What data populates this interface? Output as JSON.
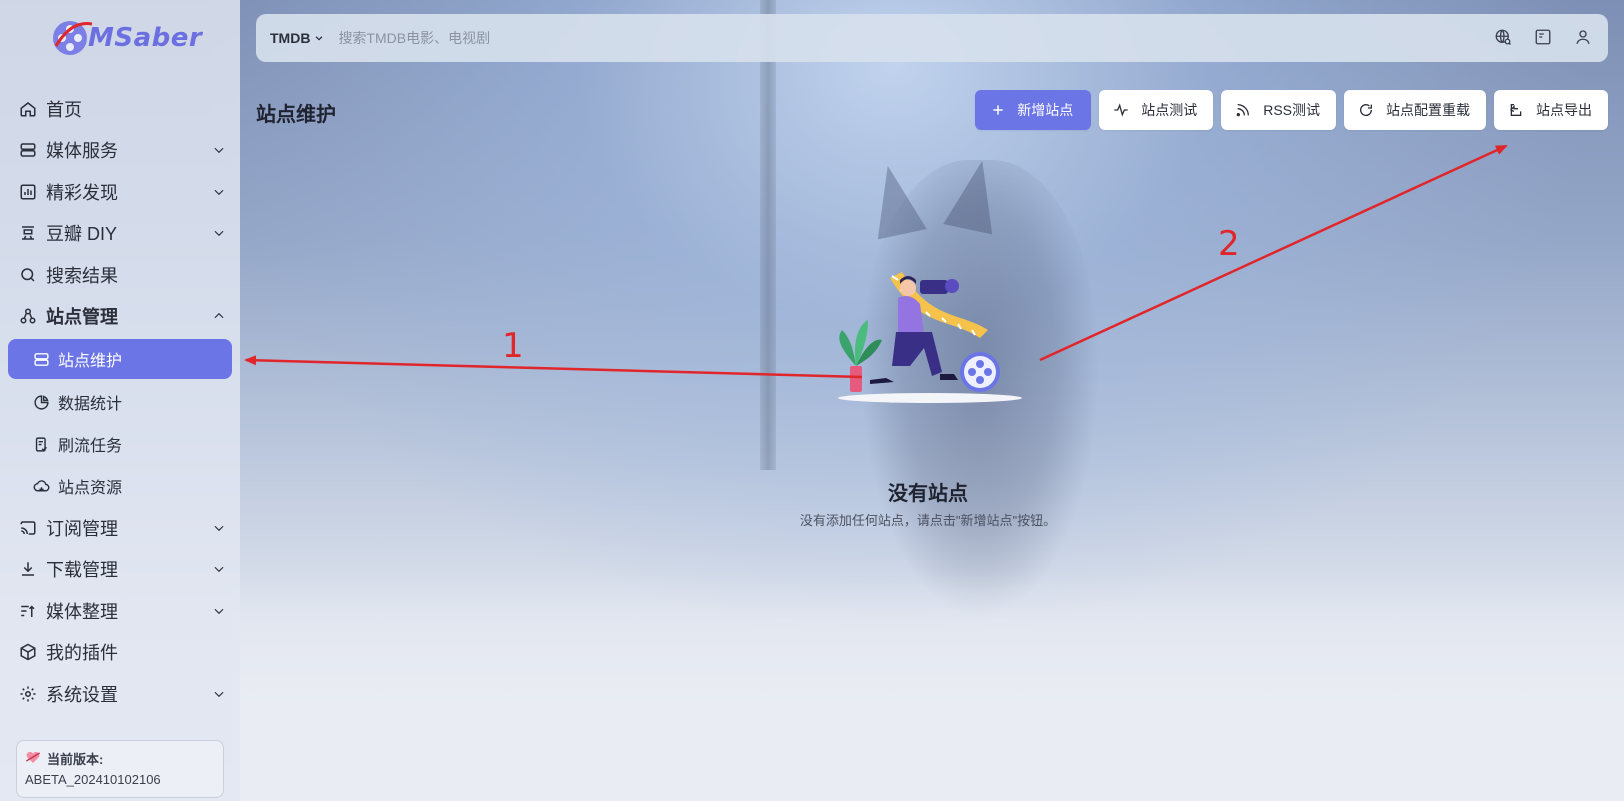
{
  "app": {
    "logo_text": "MSaber"
  },
  "sidebar": {
    "items": [
      {
        "label": "首页",
        "icon": "home-icon"
      },
      {
        "label": "媒体服务",
        "icon": "server-icon"
      },
      {
        "label": "精彩发现",
        "icon": "chart-icon"
      },
      {
        "label": "豆瓣 DIY",
        "icon": "douban-icon"
      },
      {
        "label": "搜索结果",
        "icon": "search-icon"
      },
      {
        "label": "站点管理",
        "icon": "sitemap-icon"
      },
      {
        "label": "订阅管理",
        "icon": "cast-icon"
      },
      {
        "label": "下载管理",
        "icon": "download-icon"
      },
      {
        "label": "媒体整理",
        "icon": "sort-icon"
      },
      {
        "label": "我的插件",
        "icon": "cube-icon"
      },
      {
        "label": "系统设置",
        "icon": "gear-icon"
      }
    ],
    "sub_items": [
      {
        "label": "站点维护",
        "icon": "server-icon"
      },
      {
        "label": "数据统计",
        "icon": "pie-icon"
      },
      {
        "label": "刷流任务",
        "icon": "task-icon"
      },
      {
        "label": "站点资源",
        "icon": "cloud-icon"
      }
    ],
    "version": {
      "label": "当前版本:",
      "value": "ABETA_202410102106"
    }
  },
  "topbar": {
    "source": "TMDB",
    "search_placeholder": "搜索TMDB电影、电视剧"
  },
  "header": {
    "title": "站点维护",
    "buttons": {
      "add": "新增站点",
      "test": "站点测试",
      "rss": "RSS测试",
      "reload": "站点配置重载",
      "export": "站点导出"
    }
  },
  "empty_state": {
    "title": "没有站点",
    "desc": "没有添加任何站点，请点击\"新增站点\"按钮。"
  },
  "annotations": {
    "label_1": "1",
    "label_2": "2",
    "color": "#e0262a"
  },
  "colors": {
    "accent": "#6c75e6"
  }
}
